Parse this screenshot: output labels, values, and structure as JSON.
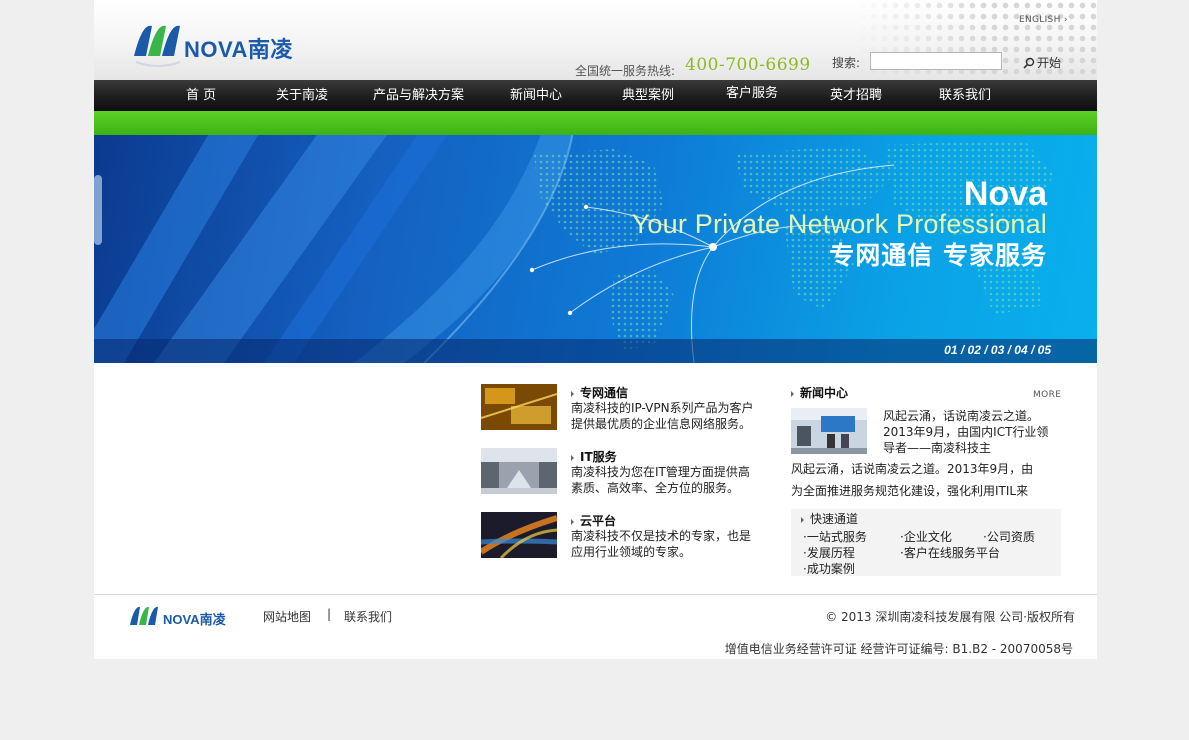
{
  "header": {
    "logo_text": "NOVA南凌",
    "english_label": "ENGLISH",
    "hotline_label": "全国统一服务热线:",
    "hotline_number": "400-700-6699",
    "search_label": "搜索:",
    "search_value": "",
    "search_button": "开始"
  },
  "nav": {
    "items": [
      {
        "label": "首 页"
      },
      {
        "label": "关于南凌"
      },
      {
        "label": "产品与解决方案"
      },
      {
        "label": "新闻中心"
      },
      {
        "label": "典型案例"
      },
      {
        "label": "客户服务"
      },
      {
        "label": "英才招聘"
      },
      {
        "label": "联系我们"
      }
    ]
  },
  "banner": {
    "title": "Nova",
    "tagline": "Your Private Network Professional",
    "cn_tagline": "专网通信  专家服务",
    "slides": [
      "01",
      "02",
      "03",
      "04",
      "05"
    ]
  },
  "services": [
    {
      "title": "专网通信",
      "desc": "南凌科技的IP-VPN系列产品为客户提供最优质的企业信息网络服务。"
    },
    {
      "title": "IT服务",
      "desc": "南凌科技为您在IT管理方面提供高素质、高效率、全方位的服务。"
    },
    {
      "title": "云平台",
      "desc": "南凌科技不仅是技术的专家，也是应用行业领域的专家。"
    }
  ],
  "news": {
    "title": "新闻中心",
    "more": "MORE",
    "headline": "风起云涌，话说南凌云之道。2013年9月，由国内ICT行业领导者——南凌科技主",
    "lines": [
      "风起云涌，话说南凌云之道。2013年9月，由",
      "为全面推进服务规范化建设，强化利用ITIL来"
    ]
  },
  "quick": {
    "title": "快速通道",
    "links": [
      "·一站式服务",
      "·企业文化",
      "·公司资质",
      "·发展历程",
      "·客户在线服务平台",
      "·成功案例"
    ]
  },
  "footer": {
    "sitemap": "网站地图",
    "separator": "|",
    "contact": "联系我们",
    "copyright": "©  2013 深圳南凌科技发展有限 公司·版权所有",
    "license": "增值电信业务经营许可证 经营许可证编号: B1.B2 - 20070058号"
  },
  "colors": {
    "brand_blue": "#1a5aa8",
    "brand_green": "#3cb214",
    "hotline_green": "#8bbb21",
    "nav_bg": "#1b1b1b"
  }
}
